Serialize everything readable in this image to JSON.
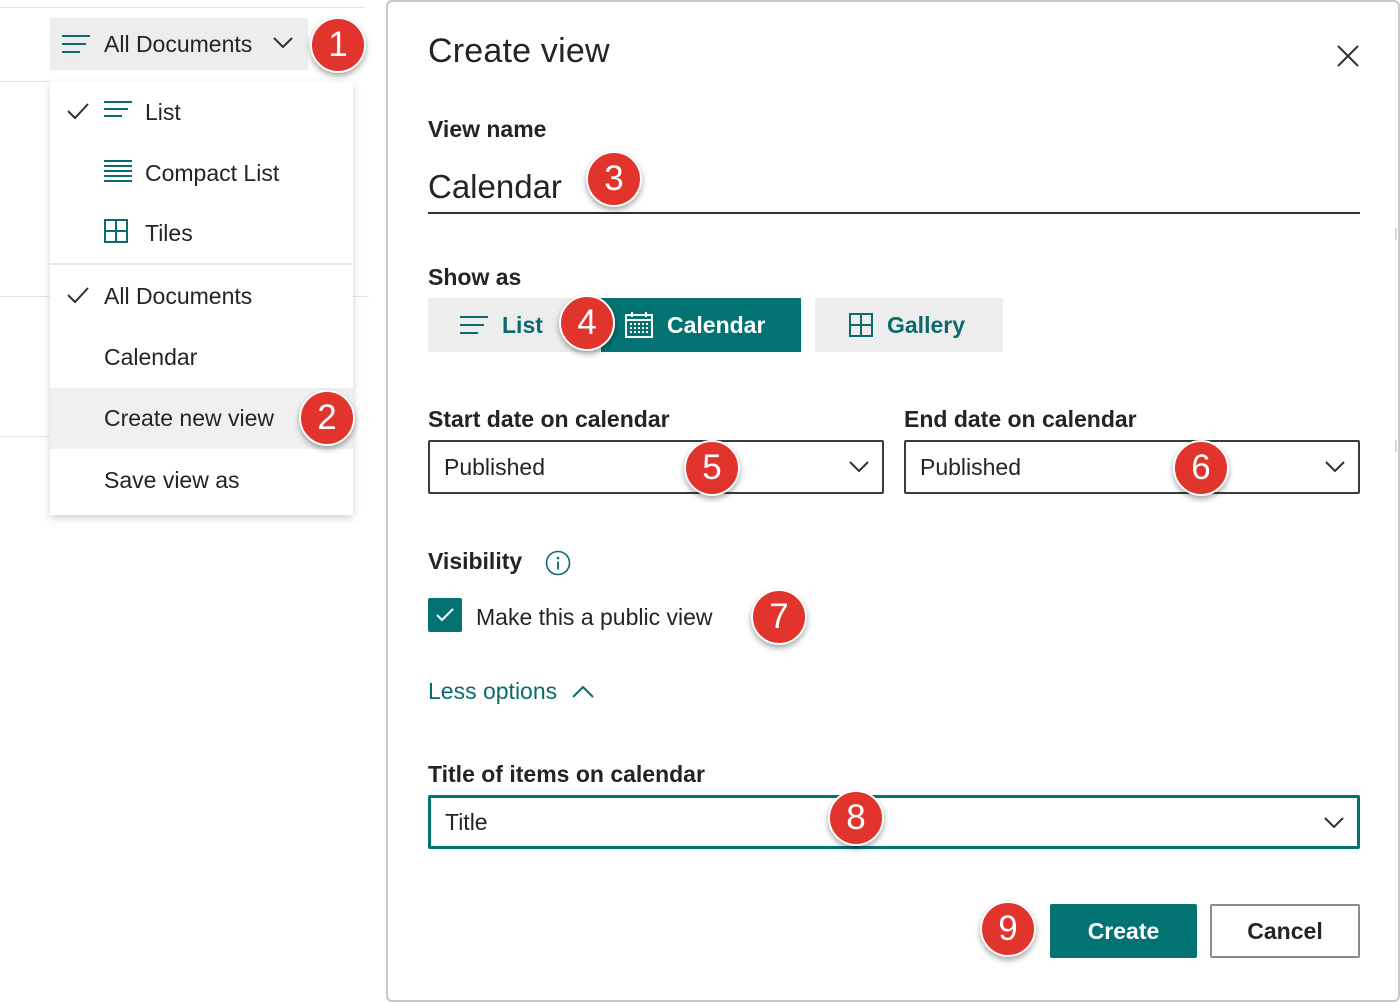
{
  "view_switcher": {
    "label": "All Documents"
  },
  "view_menu": {
    "layout_items": [
      {
        "label": "List",
        "checked": true,
        "icon": "list-lines-icon"
      },
      {
        "label": "Compact List",
        "checked": false,
        "icon": "compact-list-icon"
      },
      {
        "label": "Tiles",
        "checked": false,
        "icon": "tiles-grid-icon"
      }
    ],
    "view_items": [
      {
        "label": "All Documents",
        "checked": true
      },
      {
        "label": "Calendar",
        "checked": false
      },
      {
        "label": "Create new view",
        "checked": false,
        "highlighted": true
      },
      {
        "label": "Save view as",
        "checked": false
      }
    ]
  },
  "dialog": {
    "title": "Create view",
    "view_name_label": "View name",
    "view_name_value": "Calendar",
    "show_as_label": "Show as",
    "show_as_options": [
      {
        "label": "List",
        "selected": false,
        "icon": "list-lines-icon"
      },
      {
        "label": "Calendar",
        "selected": true,
        "icon": "calendar-icon"
      },
      {
        "label": "Gallery",
        "selected": false,
        "icon": "gallery-grid-icon"
      }
    ],
    "start_date_label": "Start date on calendar",
    "start_date_value": "Published",
    "end_date_label": "End date on calendar",
    "end_date_value": "Published",
    "visibility_label": "Visibility",
    "public_view_label": "Make this a public view",
    "public_view_checked": true,
    "less_options_label": "Less options",
    "title_items_label": "Title of items on calendar",
    "title_items_value": "Title",
    "create_label": "Create",
    "cancel_label": "Cancel"
  },
  "markers": [
    "1",
    "2",
    "3",
    "4",
    "5",
    "6",
    "7",
    "8",
    "9"
  ],
  "colors": {
    "accent": "#037273",
    "accent_text": "#0b6a6e",
    "marker": "#e0342d",
    "button_bg": "#ededed"
  }
}
